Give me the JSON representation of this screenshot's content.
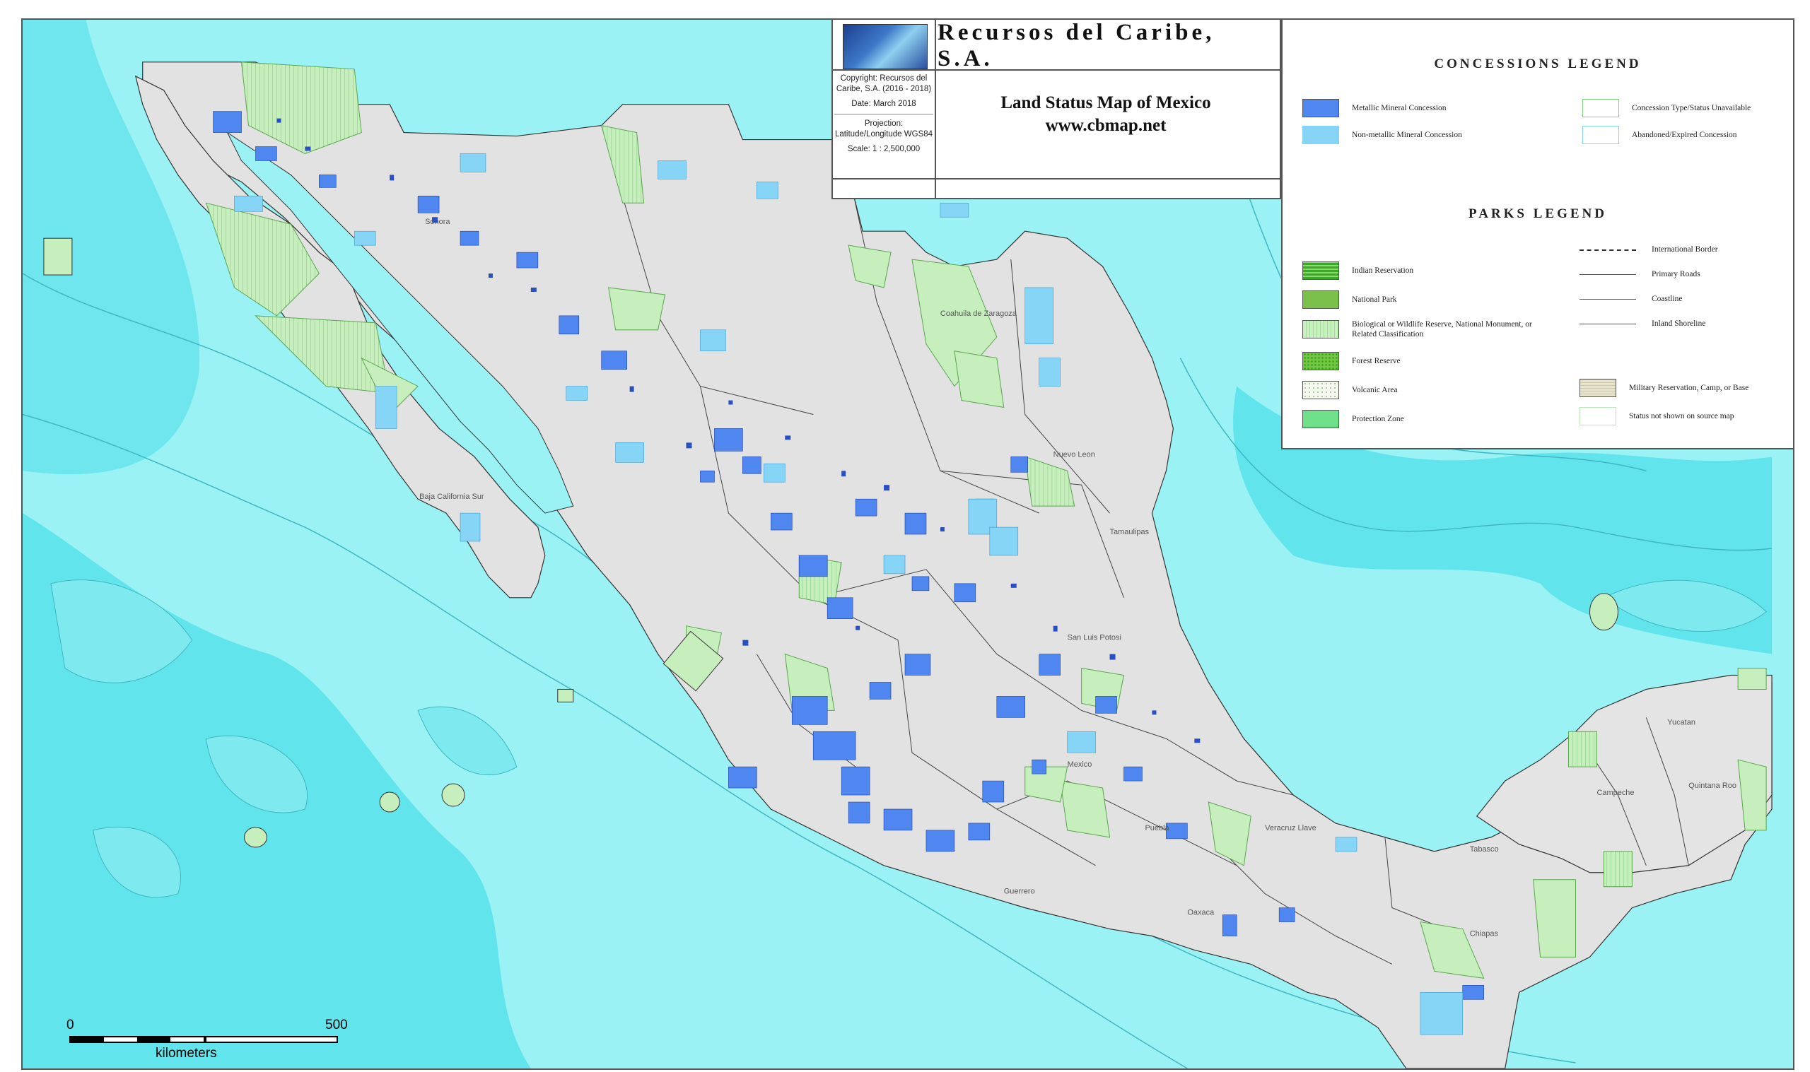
{
  "title_block": {
    "company": "Recursos del Caribe, S.A.",
    "copyright": "Copyright: Recursos del Caribe, S.A. (2016 - 2018)",
    "date": "Date: March 2018",
    "projection": "Projection: Latitude/Longitude WGS84",
    "scale": "Scale: 1 : 2,500,000",
    "map_title": "Land Status Map of Mexico",
    "url": "www.cbmap.net"
  },
  "concessions_legend": {
    "heading": "CONCESSIONS LEGEND",
    "items": [
      {
        "label": "Metallic Mineral Concession",
        "color": "#4f86f0"
      },
      {
        "label": "Non-metallic Mineral Concession",
        "color": "#86d4f6"
      },
      {
        "label": "Concession Type/Status Unavailable",
        "color": "#ffffff"
      },
      {
        "label": "Abandoned/Expired Concession",
        "color": "#ffffff"
      }
    ]
  },
  "parks_legend": {
    "heading": "PARKS LEGEND",
    "items": [
      {
        "label": "Indian Reservation",
        "color": "#3aa82a"
      },
      {
        "label": "National Park",
        "color": "#7ac04a"
      },
      {
        "label": "Biological or Wildlife Reserve, National Monument, or Related Classification",
        "color": "#c8f0c0"
      },
      {
        "label": "Forest Reserve",
        "color": "#6fc840"
      },
      {
        "label": "Volcanic Area",
        "color": "#f4f8ee"
      },
      {
        "label": "Protection Zone",
        "color": "#6fe08a"
      },
      {
        "label": "Military Reservation, Camp, or Base",
        "color": "#e8e4cc"
      },
      {
        "label": "Status not shown on source map",
        "color": "#ffffff"
      }
    ],
    "line_items": [
      {
        "label": "International Border"
      },
      {
        "label": "Primary Roads"
      },
      {
        "label": "Coastline"
      },
      {
        "label": "Inland Shoreline"
      }
    ]
  },
  "scale_bar": {
    "start": "0",
    "end": "500",
    "unit": "kilometers"
  },
  "map_labels": {
    "baja_sur": "Baja California Sur",
    "nuevo_leon": "Nuevo Leon",
    "tamaulipas": "Tamaulipas",
    "san_luis": "San Luis Potosi",
    "veracruz": "Veracruz Llave",
    "yucatan": "Yucatan",
    "campeche": "Campeche",
    "quintana_roo": "Quintana Roo",
    "tabasco": "Tabasco",
    "chiapas": "Chiapas",
    "mexico": "Mexico",
    "puebla": "Puebla",
    "guerrero": "Guerrero",
    "oaxaca": "Oaxaca",
    "sonora": "Sonora",
    "coahuila": "Coahuila de Zaragoza"
  },
  "colors": {
    "ocean": "#9af2f4",
    "deep_ocean": "#57dfe8",
    "land": "#e2e2e2",
    "metallic": "#4f86f0",
    "non_metallic": "#86d4f6",
    "reserve": "#b8eab0"
  }
}
